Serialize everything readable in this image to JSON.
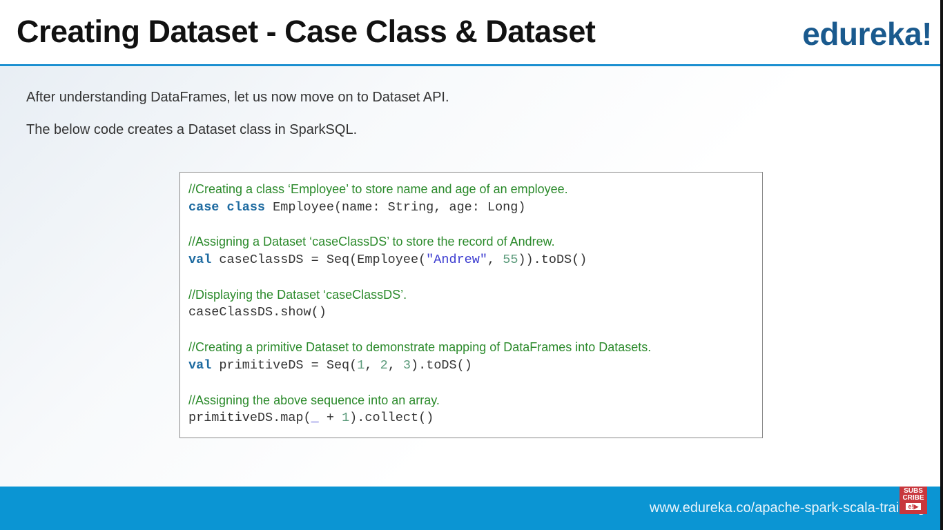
{
  "header": {
    "title": "Creating Dataset - Case Class & Dataset",
    "logo": "edureka!"
  },
  "intro": [
    "After understanding DataFrames, let us now move on to Dataset API.",
    "The below code creates a Dataset class in SparkSQL."
  ],
  "code": {
    "c1": "//Creating a class ‘Employee’ to store name and age of an employee.",
    "l1_kw": "case class",
    "l1_rest": " Employee(name: String, age: Long)",
    "c2": "//Assigning a Dataset ‘caseClassDS’ to store the record of Andrew.",
    "l2_kw": "val",
    "l2_a": " caseClassDS = Seq(Employee(",
    "l2_str": "\"Andrew\"",
    "l2_b": ", ",
    "l2_num": "55",
    "l2_c": ")).toDS()",
    "c3": "//Displaying the Dataset ‘caseClassDS’.",
    "l3": "caseClassDS.show()",
    "c4": "//Creating a primitive Dataset to demonstrate mapping of DataFrames into Datasets.",
    "l4_kw": "val",
    "l4_a": " primitiveDS = Seq(",
    "l4_n1": "1",
    "l4_s1": ", ",
    "l4_n2": "2",
    "l4_s2": ", ",
    "l4_n3": "3",
    "l4_b": ").toDS()",
    "c5": "//Assigning the above sequence into an array.",
    "l5_a": "primitiveDS.map(",
    "l5_u": "_",
    "l5_b": " + ",
    "l5_n": "1",
    "l5_c": ").collect()"
  },
  "footer": {
    "url": "www.edureka.co/apache-spark-scala-training",
    "subscribe_top": "SUBS",
    "subscribe_bottom": "CRIBE",
    "subscribe_logo": "e!▶"
  },
  "colors": {
    "accent": "#0b95d3",
    "comment": "#2b8a2b",
    "keyword": "#1d6aa0"
  }
}
